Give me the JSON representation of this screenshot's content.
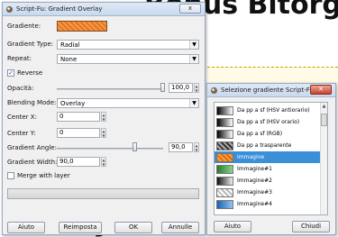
{
  "main_window": {
    "title": "Script-Fu: Gradient Overlay",
    "close_label": "x",
    "fields": {
      "gradient_label": "Gradiente:",
      "gradient_type_label": "Gradient Type:",
      "gradient_type_value": "Radial",
      "repeat_label": "Repeat:",
      "repeat_value": "None",
      "reverse_label": "Reverse",
      "reverse_checked": true,
      "opacity_label": "Opacità:",
      "opacity_value": "100,0",
      "blending_label": "Blending Mode:",
      "blending_value": "Overlay",
      "center_x_label": "Center X:",
      "center_x_value": "0",
      "center_y_label": "Center Y:",
      "center_y_value": "0",
      "angle_label": "Gradient Angle:",
      "angle_value": "90,0",
      "width_label": "Gradient Width:",
      "width_value": "90,0",
      "merge_label": "Merge with layer",
      "merge_checked": false
    },
    "buttons": {
      "help": "Aiuto",
      "reset": "Reimposta",
      "ok": "OK",
      "cancel": "Annulle"
    }
  },
  "gradient_window": {
    "title": "Selezione gradiente Script-Fu",
    "close_label": "✕",
    "items": [
      {
        "name": "Da pp a sf (HSV antiorario)",
        "swatch": "linear-gradient(90deg,#000,#fff)"
      },
      {
        "name": "Da pp a sf (HSV orario)",
        "swatch": "linear-gradient(90deg,#000,#fff)"
      },
      {
        "name": "Da pp a sf (RGB)",
        "swatch": "linear-gradient(90deg,#000,#fff)"
      },
      {
        "name": "Da pp a trasparente",
        "swatch": "linear-gradient(90deg,#000,#bbb)"
      },
      {
        "name": "Immagine",
        "swatch": "linear-gradient(90deg,#e06a10,#f7a040)"
      },
      {
        "name": "Immagine#1",
        "swatch": "linear-gradient(90deg,#2c7a2c,#8fd08f)"
      },
      {
        "name": "Immagine#2",
        "swatch": "linear-gradient(90deg,#111,#eee)"
      },
      {
        "name": "Immagine#3",
        "swatch": "linear-gradient(90deg,#bbb,#fff)"
      },
      {
        "name": "Immagine#4",
        "swatch": "linear-gradient(90deg,#1f5fb0,#8ec5f0)"
      }
    ],
    "selected_index": 4,
    "buttons": {
      "help": "Aiuto",
      "close": "Chiudi"
    }
  },
  "colors": {
    "accent": "#3b8fd9",
    "gradient_preview": "#e8731a"
  }
}
